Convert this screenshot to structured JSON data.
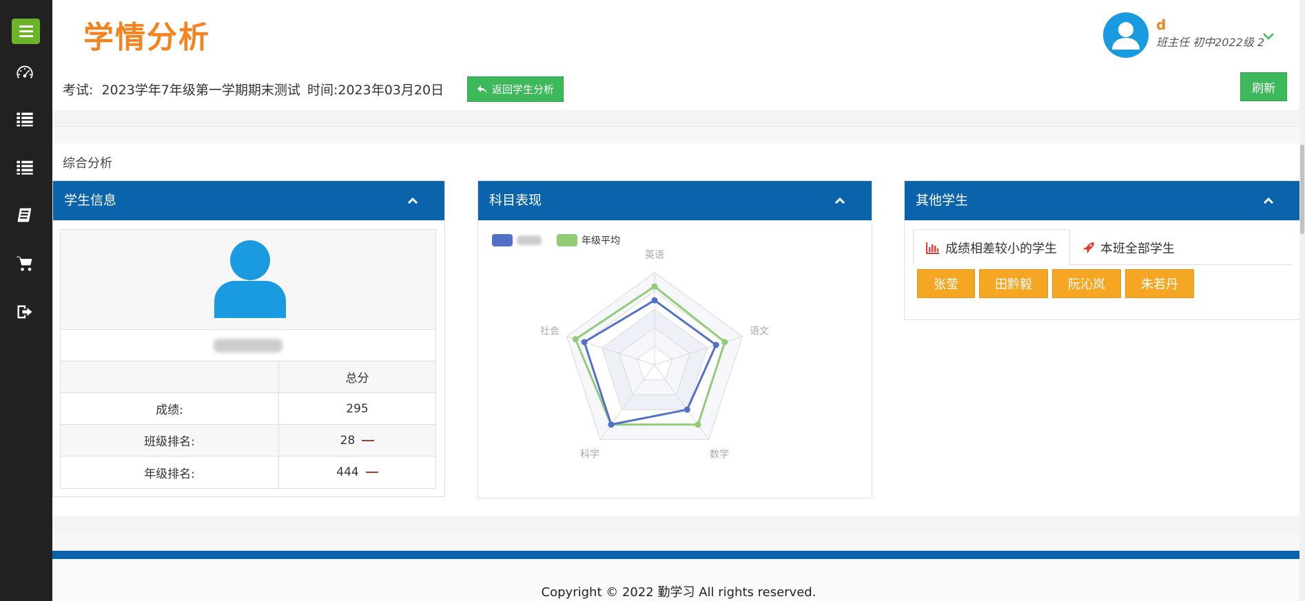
{
  "app": {
    "title": "学情分析"
  },
  "user": {
    "name": "d",
    "role": "班主任 初中2022级 2"
  },
  "sidebar": {
    "items": [
      {
        "icon": "menu-icon"
      },
      {
        "icon": "dashboard-icon"
      },
      {
        "icon": "list-icon"
      },
      {
        "icon": "list-icon"
      },
      {
        "icon": "book-icon"
      },
      {
        "icon": "cart-icon"
      },
      {
        "icon": "logout-icon"
      }
    ]
  },
  "exam": {
    "label": "考试:",
    "name": "2023学年7年级第一学期期末测试",
    "time_label": "时间:",
    "time": "2023年03月20日",
    "back_button": "返回学生分析",
    "refresh_button": "刷新"
  },
  "section": {
    "title": "综合分析"
  },
  "student_panel": {
    "title": "学生信息",
    "table_header": "总分",
    "rows": [
      {
        "label": "成绩:",
        "value": "295"
      },
      {
        "label": "班级排名:",
        "value": "28"
      },
      {
        "label": "年级排名:",
        "value": "444"
      }
    ]
  },
  "subject_panel": {
    "title": "科目表现"
  },
  "other_panel": {
    "title": "其他学生",
    "tabs": [
      "成绩相差较小的学生",
      "本班全部学生"
    ],
    "students": [
      "张莹",
      "田黔毅",
      "阮沁岚",
      "朱若丹"
    ]
  },
  "chart_data": {
    "type": "radar",
    "indicators": [
      "英语",
      "语文",
      "数学",
      "科学",
      "社会"
    ],
    "series": [
      {
        "name": "",
        "color": "#5470c6",
        "values": [
          0.7,
          0.7,
          0.6,
          0.8,
          0.8
        ]
      },
      {
        "name": "年级平均",
        "color": "#91cc75",
        "values": [
          0.85,
          0.8,
          0.8,
          0.8,
          0.9
        ]
      }
    ],
    "max": 1
  },
  "footer": {
    "copyright": "Copyright © 2022 勤学习 All rights reserved."
  },
  "colors": {
    "brand": "#f2831f",
    "primary": "#0b63ac",
    "success": "#3db85a",
    "warning": "#f5a623",
    "sidebar": "#212121"
  }
}
